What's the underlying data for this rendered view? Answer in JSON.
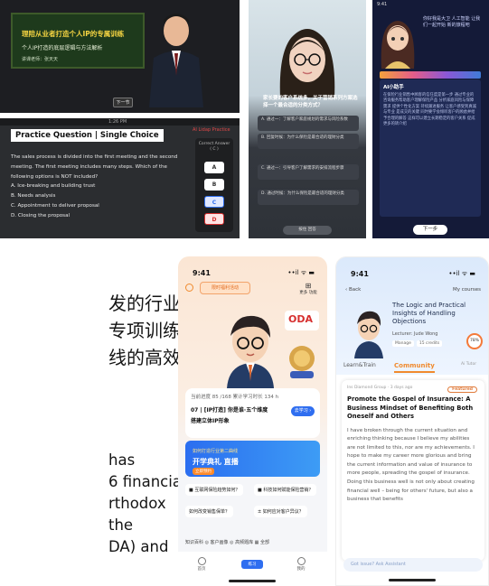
{
  "video": {
    "board_line1": "理陪从业者打造个人IP的专属训练",
    "board_line2": "个人IP打造的底层逻辑与方法解析",
    "board_line3": "讲课老师：张天天",
    "button": "下一节"
  },
  "practice": {
    "status": "1:26 PM",
    "title": "Practice Question | Single Choice",
    "tag": "AI Lidap Practice",
    "question": "The sales process is divided into the first meeting and the second meeting. The first meeting includes many steps. Which of the following options is NOT included?",
    "options": [
      "A. Ice-breaking and building trust",
      "B. Needs analysis",
      "C. Appointment to deliver proposal",
      "D. Closing the proposal"
    ],
    "panel_label": "Correct Answer ( C )",
    "letters": [
      "A",
      "B",
      "C",
      "D"
    ]
  },
  "avatar_phone": {
    "question": "家长要的客户系统多，关于营销系列方案选择一个最合适的分类方式？",
    "bubbles": [
      "A. 通过一：了解客户家庭规划的需求与风险系数",
      "B. 回复时候：为什么保险是最合适的理财分类",
      "C. 通过一：引导客户了解需求的安排流程步骤",
      "D. 通过时候：为什么保险是最合适的理财分类"
    ],
    "answer_button": "按住 回答"
  },
  "story_phone": {
    "status": "9:41",
    "quote": "你好我是大卫 人工智能 让我们一起开始 新的旅程吧",
    "card_title": "AI小助手",
    "card_text": "在保险行业销售中顾客的信任度是第一步 通过专业的咨询服务帮助客户理解保险产品 分析家庭风险与保障需求 提供个性化方案 持续跟进服务 让客户感受到真诚与专业 是成交的关键 同时要学会倾听客户的顾虑并给予合理的解答 这样可以建立长期稳定的客户关系 促成更多的转介绍",
    "next": "下一步"
  },
  "left_text": {
    "cn": [
      "发的行业专",
      "专项训练，",
      "线的高效转"
    ],
    "en": [
      "has",
      "6 financial",
      "rthodox",
      "the",
      "DA) and"
    ]
  },
  "app_home": {
    "time": "9:41",
    "signal": "••il ᯤ ▬",
    "pill": "限时福利活动",
    "grid_label": "更多 功能",
    "badge": "ODA",
    "progress": "当前进度 85 /168   累计学习时长 134 h",
    "lesson1": "07 | [IP打造] 你是谁·五个维度",
    "lesson2": "搭建立体IP形象",
    "go": "去学习 ›",
    "banner_small": "如何打造行业第二曲线",
    "banner_big": "开学典礼 直播",
    "banner_badge": "立即预约",
    "q1": "■ 互联网保险趋势如何？",
    "q2": "■ 科技如何赋能保险营销？",
    "q3": "如何改变销售保单？",
    "q4": "± 如何应对客户异议？",
    "chips": "知识百科  ◎ 客户画像  ◎ 高频题库  ▦ 全部",
    "tabs": [
      "首页",
      "练习",
      "我的"
    ]
  },
  "app_course": {
    "time": "9:41",
    "signal": "••il ᯤ ▬",
    "back": "‹ Back",
    "my_courses": "My courses",
    "title": "The Logic and Practical Insights of Handling Objections",
    "lecturer": "Lecturer: Jude Wong",
    "meta": [
      "Manage",
      "15 credits"
    ],
    "pct": "78%",
    "tabs": [
      "Learn&Train",
      "Community",
      "Ai Tutor"
    ],
    "post_meta": "Ins Diamond Group · 3 days ago",
    "post_badge": "Featured",
    "post_title": "Promote the Gospel of Insurance: A Business Mindset of Benefiting Both Oneself and Others",
    "post_body": "I have broken through the current situation and enriching thinking because I believe my abilities are not limited to this, nor are my achievements. I hope to make my career more glorious and bring the current information and value of insurance to more people, spreading the gospel of insurance. Doing this business well is not only about creating financial well – being for others' future, but also a business that benefits",
    "input_placeholder": "Got issue?  Ask Assistant"
  },
  "colors": {
    "accent": "#2f6ef0",
    "orange": "#f08a2d",
    "red": "#d62f2f"
  }
}
